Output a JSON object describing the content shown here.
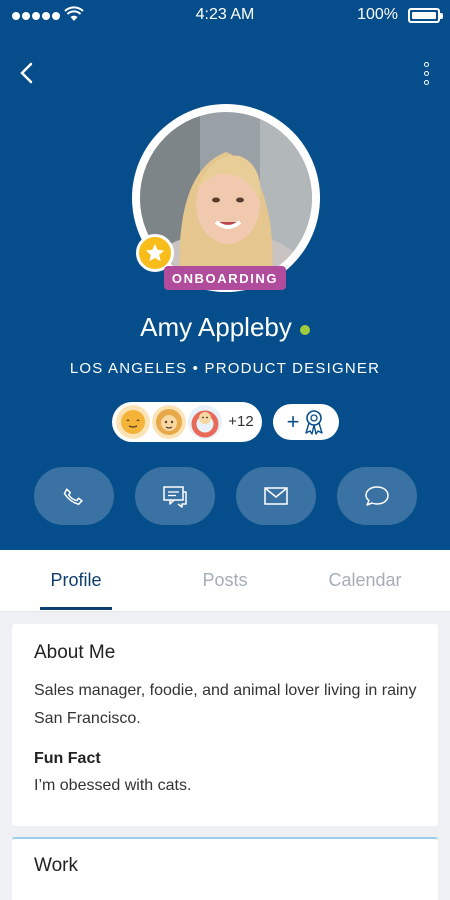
{
  "status_bar": {
    "time": "4:23 AM",
    "battery": "100%"
  },
  "profile": {
    "badge_label": "ONBOARDING",
    "name": "Amy Appleby",
    "subtitle": "LOS ANGELES • PRODUCT DESIGNER",
    "badge_count": "+12",
    "award_plus": "+"
  },
  "actions": [
    {
      "icon": "phone-icon"
    },
    {
      "icon": "chat-icon"
    },
    {
      "icon": "mail-icon"
    },
    {
      "icon": "speech-bubble-icon"
    }
  ],
  "tabs": [
    {
      "label": "Profile",
      "active": true
    },
    {
      "label": "Posts",
      "active": false
    },
    {
      "label": "Calendar",
      "active": false
    }
  ],
  "about": {
    "title": "About Me",
    "text": "Sales manager, foodie, and animal lover living in rainy San Francisco.",
    "fun_fact_title": "Fun Fact",
    "fun_fact_text": "I’m obessed with cats."
  },
  "work": {
    "title": "Work"
  },
  "colors": {
    "header_bg": "#064e8b",
    "badge_purple": "#b04c9b",
    "star_yellow": "#f8bd1a",
    "online_green": "#9fcb3c",
    "tab_active": "#0d3e70"
  }
}
